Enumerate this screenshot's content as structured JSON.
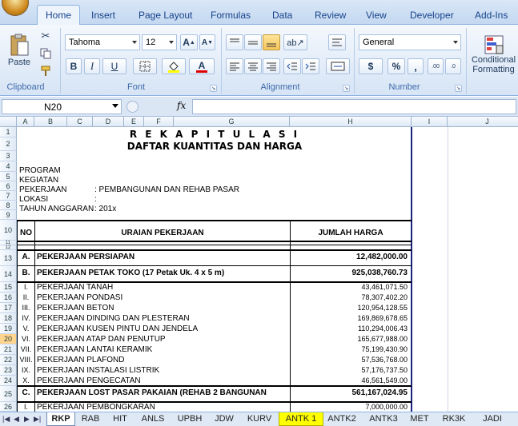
{
  "ribbon": {
    "tabs": [
      "Home",
      "Insert",
      "Page Layout",
      "Formulas",
      "Data",
      "Review",
      "View",
      "Developer",
      "Add-Ins"
    ],
    "active_tab": "Home",
    "clipboard": {
      "paste": "Paste",
      "label": "Clipboard"
    },
    "font": {
      "name": "Tahoma",
      "size": "12",
      "bold": "B",
      "italic": "I",
      "underline": "U",
      "label": "Font"
    },
    "alignment": {
      "label": "Alignment"
    },
    "number": {
      "format": "General",
      "currency": "$",
      "percent": "%",
      "comma": ",",
      "label": "Number"
    },
    "styles": {
      "conditional": "Conditional",
      "formatting": "Formatting"
    }
  },
  "formula_bar": {
    "name_box": "N20",
    "fx": "fx",
    "content": ""
  },
  "columns": [
    "A",
    "B",
    "C",
    "D",
    "E",
    "F",
    "G",
    "H",
    "I",
    "J"
  ],
  "rows": [
    "1",
    "2",
    "3",
    "4",
    "5",
    "6",
    "7",
    "8",
    "9",
    "10",
    "11",
    "12",
    "13",
    "14",
    "15",
    "16",
    "17",
    "18",
    "19",
    "20",
    "21",
    "22",
    "23",
    "24",
    "25",
    "26"
  ],
  "selected_row": "20",
  "sheet": {
    "title1": "R E K A P I T U L A S I",
    "title2": "DAFTAR KUANTITAS DAN HARGA",
    "info": [
      {
        "label": "PROGRAM",
        "value": ""
      },
      {
        "label": "KEGIATAN",
        "value": ""
      },
      {
        "label": "PEKERJAAN",
        "value": ": PEMBANGUNAN DAN REHAB PASAR"
      },
      {
        "label": "LOKASI",
        "value": ":"
      },
      {
        "label": "TAHUN ANGGARAN",
        "value": ": 201x"
      }
    ],
    "header": {
      "no": "NO",
      "uraian": "URAIAN PEKERJAAN",
      "jumlah": "JUMLAH HARGA"
    },
    "sections": [
      {
        "no": "A.",
        "label": "PEKERJAAN PERSIAPAN",
        "value": "12,482,000.00"
      },
      {
        "no": "B.",
        "label": "PEKERJAAN PETAK TOKO (17 Petak Uk. 4 x 5 m)",
        "value": "925,038,760.73"
      }
    ],
    "items": [
      {
        "no": "I.",
        "label": "PEKERJAAN TANAH",
        "value": "43,461,071.50"
      },
      {
        "no": "II.",
        "label": "PEKERJAAN PONDASI",
        "value": "78,307,402.20"
      },
      {
        "no": "III.",
        "label": "PEKERJAAN BETON",
        "value": "120,954,128.55"
      },
      {
        "no": "IV.",
        "label": "PEKERJAAN DINDING DAN PLESTERAN",
        "value": "169,869,678.65"
      },
      {
        "no": "V.",
        "label": "PEKERJAAN KUSEN PINTU DAN JENDELA",
        "value": "110,294,006.43"
      },
      {
        "no": "VI.",
        "label": "PEKERJAAN ATAP DAN PENUTUP",
        "value": "165,677,988.00"
      },
      {
        "no": "VII.",
        "label": "PEKERJAAN LANTAI KERAMIK",
        "value": "75,199,430.90"
      },
      {
        "no": "VIII.",
        "label": "PEKERJAAN PLAFOND",
        "value": "57,536,768.00"
      },
      {
        "no": "IX.",
        "label": "PEKERJAAN INSTALASI LISTRIK",
        "value": "57,176,737.50"
      },
      {
        "no": "X.",
        "label": "PEKERJAAN PENGECATAN",
        "value": "46,561,549.00"
      }
    ],
    "section_c": {
      "no": "C.",
      "label": "PEKERJAAN LOST PASAR PAKAIAN (REHAB 2 BANGUNAN",
      "value": "561,167,024.95"
    },
    "item_c1": {
      "no": "I.",
      "label": "PEKERJAAN PEMBONGKARAN",
      "value": "7,000,000.00"
    }
  },
  "sheet_tabs": [
    "RKP",
    "RAB",
    "HIT",
    "ANLS",
    "UPBH",
    "JDW",
    "KURV",
    "ANTK 1",
    "ANTK2",
    "ANTK3",
    "MET",
    "RK3K",
    "JADI"
  ],
  "active_sheet": "RKP",
  "highlight_sheet": "ANTK 1"
}
